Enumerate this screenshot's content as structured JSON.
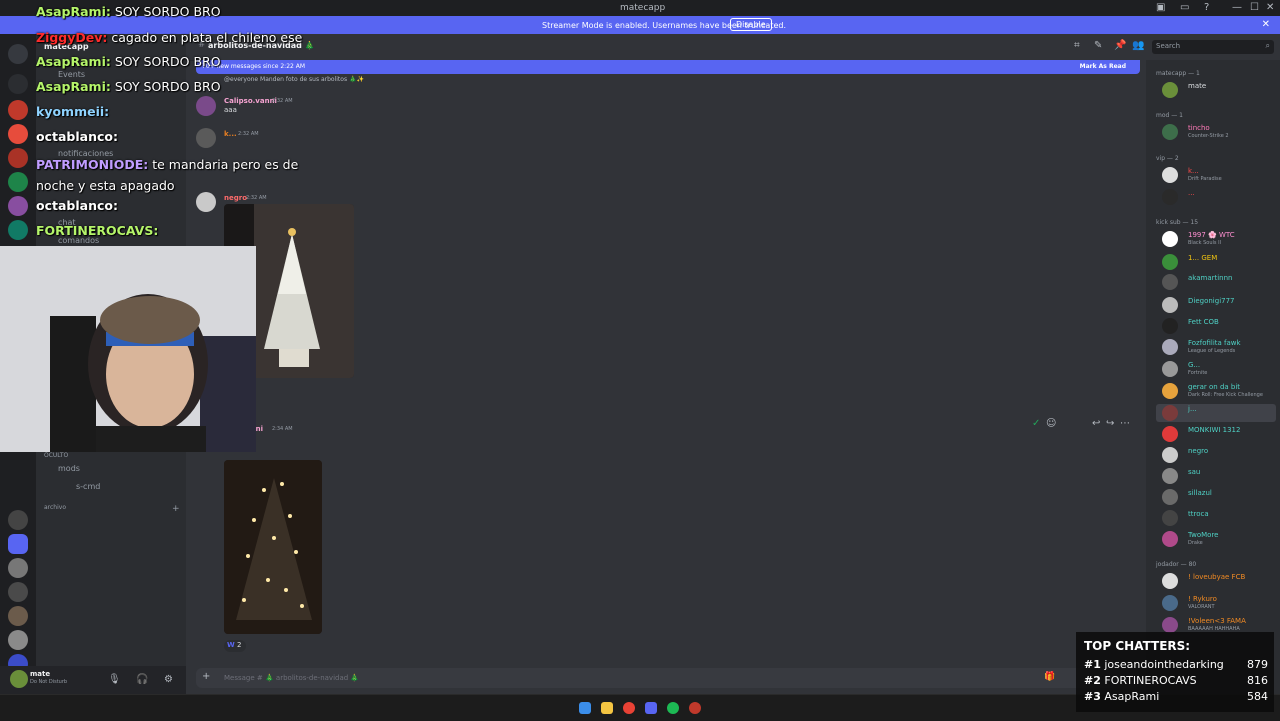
{
  "window": {
    "title": "matecapp",
    "controls": [
      "—",
      "☐",
      "✕"
    ]
  },
  "banner": {
    "message": "Streamer Mode is enabled. Usernames have been truncated.",
    "disable_label": "Disable",
    "close": "✕"
  },
  "server": {
    "name": "matecapp",
    "events_label": "Events"
  },
  "channels": [
    {
      "name": "arbolitos-de-navidad 🎄"
    },
    {
      "name": "notificaciones"
    },
    {
      "name": "chat"
    },
    {
      "name": "comandos"
    },
    {
      "name": "mods"
    },
    {
      "name": "s-cmd"
    }
  ],
  "categories": {
    "oculto": "OCULTO",
    "archivo": "archivo"
  },
  "header": {
    "channel": "arbolitos-de-navidad 🎄",
    "search_placeholder": "Search"
  },
  "new_messages": {
    "text": "70+ new messages since 2:22 AM",
    "mark_read": "Mark As Read"
  },
  "pinned_preview": "@everyone Manden foto de sus arbolitos 🎄✨",
  "messages": [
    {
      "author": "Calipso.vanni",
      "time": "2:32 AM",
      "text": "aaa"
    },
    {
      "author": "k...",
      "time": "2:32 AM",
      "text": ""
    },
    {
      "author": "negro",
      "time": "2:32 AM",
      "text": ""
    },
    {
      "author": "...anni",
      "time": "2:34 AM",
      "text": ""
    }
  ],
  "reaction": {
    "count": "2"
  },
  "composer": {
    "placeholder": "Message # 🎄 arbolitos-de-navidad 🎄"
  },
  "user_panel": {
    "name": "mate",
    "status": "Do Not Disturb"
  },
  "members": {
    "groups": [
      {
        "label": "matecapp — 1",
        "items": [
          {
            "name": "mate",
            "status": ""
          }
        ]
      },
      {
        "label": "mod — 1",
        "items": [
          {
            "name": "tincho",
            "status": "Counter-Strike 2"
          }
        ]
      },
      {
        "label": "vip — 2",
        "items": [
          {
            "name": "k...",
            "status": "Drift Paradise"
          },
          {
            "name": "...",
            "status": ""
          }
        ]
      },
      {
        "label": "kick sub — 15",
        "items": [
          {
            "name": "1997 🌸 WTC",
            "status": "Black Souls II"
          },
          {
            "name": "1... GEM",
            "status": ""
          },
          {
            "name": "akamartinnn",
            "status": ""
          },
          {
            "name": "Diegonigi777",
            "status": ""
          },
          {
            "name": "Fett COB",
            "status": ""
          },
          {
            "name": "Fozfofilita fawk",
            "status": "League of Legends"
          },
          {
            "name": "G...",
            "status": "Fortnite"
          },
          {
            "name": "gerar on da bit",
            "status": "Dark Roll: Free Kick Challenge"
          },
          {
            "name": "j...",
            "status": ""
          },
          {
            "name": "MONKIWI 1312",
            "status": ""
          },
          {
            "name": "negro",
            "status": ""
          },
          {
            "name": "sau",
            "status": ""
          },
          {
            "name": "sillazul",
            "status": ""
          },
          {
            "name": "ttroca",
            "status": ""
          },
          {
            "name": "TwoMore",
            "status": "Drake"
          }
        ]
      },
      {
        "label": "jodador — 80",
        "items": [
          {
            "name": "! loveubyae FCB",
            "status": ""
          },
          {
            "name": "! Rykuro",
            "status": "VALORANT"
          },
          {
            "name": "!Voleen<3 FAMA",
            "status": "BAAAAAH HAHHAHA"
          }
        ]
      }
    ]
  },
  "overlay_chat": [
    {
      "user": "AsapRami:",
      "text": "SOY SORDO BRO",
      "color": "#b5f56a"
    },
    {
      "user": "ZiggyDev:",
      "text": "cagado en plata el chileno ese",
      "color": "#ff2b2b"
    },
    {
      "user": "AsapRami:",
      "text": "SOY SORDO BRO",
      "color": "#b5f56a"
    },
    {
      "user": "AsapRami:",
      "text": "SOY SORDO BRO",
      "color": "#b5f56a"
    },
    {
      "user": "kyommeii:",
      "text": "",
      "color": "#8fd3ff"
    },
    {
      "user": "octablanco:",
      "text": "",
      "color": "#ffffff"
    },
    {
      "user": "PATRIMONIODE:",
      "text": "te mandaria pero es de noche y esta apagado",
      "color": "#c09cff"
    },
    {
      "user": "octablanco:",
      "text": "",
      "color": "#ffffff"
    },
    {
      "user": "FORTINEROCAVS:",
      "text": "",
      "color": "#b5f56a"
    }
  ],
  "top_chatters": {
    "title": "TOP CHATTERS:",
    "rows": [
      {
        "rank": "#1",
        "name": "joseandointhedarking",
        "count": "879"
      },
      {
        "rank": "#2",
        "name": "FORTINEROCAVS",
        "count": "816"
      },
      {
        "rank": "#3",
        "name": "AsapRami",
        "count": "584"
      }
    ]
  },
  "colors": {
    "blurple": "#5865f2",
    "bg": "#313338",
    "sidebar": "#2b2d31",
    "rail": "#1e1f22"
  }
}
